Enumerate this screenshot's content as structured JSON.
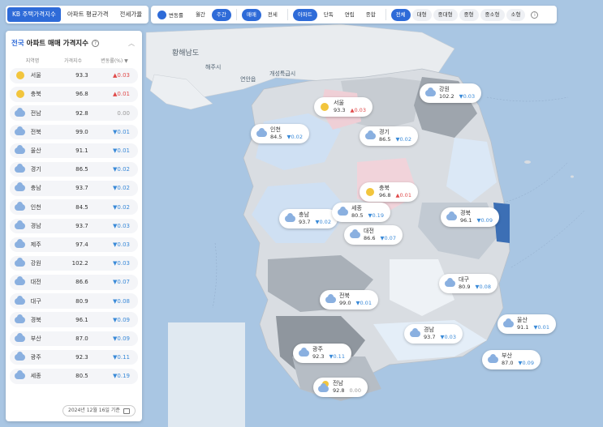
{
  "tabs": [
    {
      "label": "KB 주택가격지수",
      "active": true
    },
    {
      "label": "아파트 평균가격",
      "active": false
    },
    {
      "label": "전세가율",
      "active": false
    }
  ],
  "filters": {
    "toggle_label": "변동률",
    "period": [
      {
        "label": "월간",
        "on": false
      },
      {
        "label": "주간",
        "on": true
      }
    ],
    "trade": [
      {
        "label": "매매",
        "on": true
      },
      {
        "label": "전세",
        "on": false
      }
    ],
    "housing": [
      {
        "label": "아파트",
        "on": true
      },
      {
        "label": "단독",
        "on": false
      },
      {
        "label": "연립",
        "on": false
      },
      {
        "label": "종합",
        "on": false
      }
    ],
    "size": [
      {
        "label": "전체",
        "on": true
      },
      {
        "label": "대형",
        "on": false
      },
      {
        "label": "중대형",
        "on": false
      },
      {
        "label": "중형",
        "on": false
      },
      {
        "label": "중소형",
        "on": false
      },
      {
        "label": "소형",
        "on": false
      }
    ]
  },
  "panel": {
    "region": "전국",
    "title": "아파트 매매 가격지수",
    "headers": {
      "region": "지역명",
      "index": "가격지수",
      "change": "변동률(%) ▼"
    },
    "date": "2024년 12월 16일 기준",
    "rows": [
      {
        "name": "서울",
        "index": "93.3",
        "change": "▲0.03",
        "dir": "up",
        "icon": "sun"
      },
      {
        "name": "충북",
        "index": "96.8",
        "change": "▲0.01",
        "dir": "up",
        "icon": "sun"
      },
      {
        "name": "전남",
        "index": "92.8",
        "change": "0.00",
        "dir": "zero",
        "icon": "cloud"
      },
      {
        "name": "전북",
        "index": "99.0",
        "change": "▼0.01",
        "dir": "dn",
        "icon": "cloud"
      },
      {
        "name": "울산",
        "index": "91.1",
        "change": "▼0.01",
        "dir": "dn",
        "icon": "cloud"
      },
      {
        "name": "경기",
        "index": "86.5",
        "change": "▼0.02",
        "dir": "dn",
        "icon": "cloud"
      },
      {
        "name": "충남",
        "index": "93.7",
        "change": "▼0.02",
        "dir": "dn",
        "icon": "cloud"
      },
      {
        "name": "인천",
        "index": "84.5",
        "change": "▼0.02",
        "dir": "dn",
        "icon": "cloud"
      },
      {
        "name": "경남",
        "index": "93.7",
        "change": "▼0.03",
        "dir": "dn",
        "icon": "cloud"
      },
      {
        "name": "제주",
        "index": "97.4",
        "change": "▼0.03",
        "dir": "dn",
        "icon": "cloud"
      },
      {
        "name": "강원",
        "index": "102.2",
        "change": "▼0.03",
        "dir": "dn",
        "icon": "cloud"
      },
      {
        "name": "대전",
        "index": "86.6",
        "change": "▼0.07",
        "dir": "dn",
        "icon": "cloud"
      },
      {
        "name": "대구",
        "index": "80.9",
        "change": "▼0.08",
        "dir": "dn",
        "icon": "cloud"
      },
      {
        "name": "경북",
        "index": "96.1",
        "change": "▼0.09",
        "dir": "dn",
        "icon": "cloud"
      },
      {
        "name": "부산",
        "index": "87.0",
        "change": "▼0.09",
        "dir": "dn",
        "icon": "cloud"
      },
      {
        "name": "광주",
        "index": "92.3",
        "change": "▼0.11",
        "dir": "dn",
        "icon": "cloud"
      },
      {
        "name": "세종",
        "index": "80.5",
        "change": "▼0.19",
        "dir": "dn",
        "icon": "cloud"
      }
    ]
  },
  "map": {
    "labels": [
      "황해남도",
      "해주시",
      "연안읍",
      "개성특급시",
      "황해남도 "
    ],
    "bubbles": [
      {
        "name": "서울",
        "index": "93.3",
        "change": "▲0.03",
        "dir": "up",
        "icon": "sun"
      },
      {
        "name": "강원",
        "index": "102.2",
        "change": "▼0.03",
        "dir": "dn",
        "icon": "cloud"
      },
      {
        "name": "인천",
        "index": "84.5",
        "change": "▼0.02",
        "dir": "dn",
        "icon": "cloud"
      },
      {
        "name": "경기",
        "index": "86.5",
        "change": "▼0.02",
        "dir": "dn",
        "icon": "cloud"
      },
      {
        "name": "충북",
        "index": "96.8",
        "change": "▲0.01",
        "dir": "up",
        "icon": "sun"
      },
      {
        "name": "충남",
        "index": "93.7",
        "change": "▼0.02",
        "dir": "dn",
        "icon": "cloud"
      },
      {
        "name": "세종",
        "index": "80.5",
        "change": "▼0.19",
        "dir": "dn",
        "icon": "cloud"
      },
      {
        "name": "경북",
        "index": "96.1",
        "change": "▼0.09",
        "dir": "dn",
        "icon": "cloud"
      },
      {
        "name": "대전",
        "index": "86.6",
        "change": "▼0.07",
        "dir": "dn",
        "icon": "cloud"
      },
      {
        "name": "대구",
        "index": "80.9",
        "change": "▼0.08",
        "dir": "dn",
        "icon": "cloud"
      },
      {
        "name": "전북",
        "index": "99.0",
        "change": "▼0.01",
        "dir": "dn",
        "icon": "cloud"
      },
      {
        "name": "울산",
        "index": "91.1",
        "change": "▼0.01",
        "dir": "dn",
        "icon": "cloud"
      },
      {
        "name": "경남",
        "index": "93.7",
        "change": "▼0.03",
        "dir": "dn",
        "icon": "cloud"
      },
      {
        "name": "광주",
        "index": "92.3",
        "change": "▼0.11",
        "dir": "dn",
        "icon": "cloud"
      },
      {
        "name": "부산",
        "index": "87.0",
        "change": "▼0.09",
        "dir": "dn",
        "icon": "cloud"
      },
      {
        "name": "전남",
        "index": "92.8",
        "change": "0.00",
        "dir": "zero",
        "icon": "sun-cloud"
      }
    ]
  }
}
